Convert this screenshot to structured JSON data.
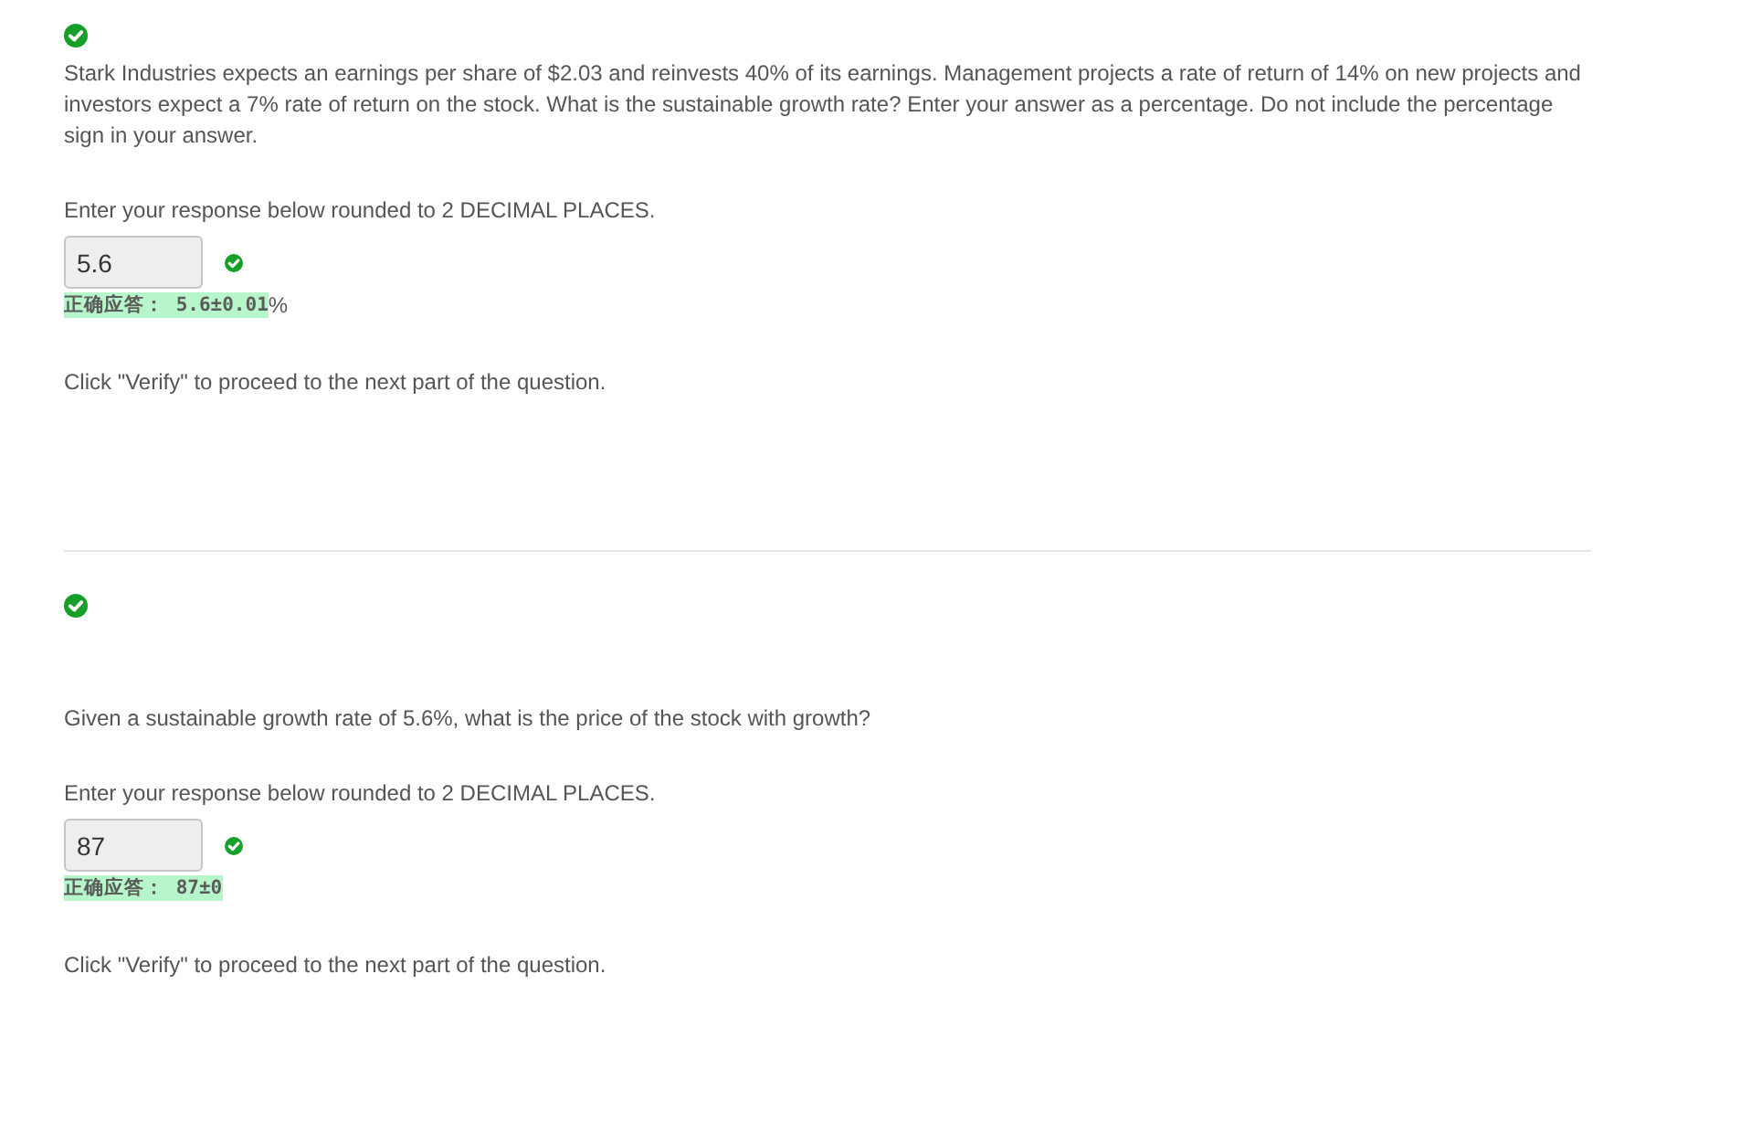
{
  "parts": [
    {
      "correct": true,
      "question": "Stark Industries expects an earnings per share of $2.03 and reinvests 40% of its earnings. Management projects a rate of return of 14% on new projects and investors expect a 7% rate of return on the stock. What is the sustainable growth rate? Enter your answer as a percentage. Do not include the percentage sign in your answer.",
      "instruction": "Enter your response below rounded to 2 DECIMAL PLACES.",
      "response": {
        "value": "5.6",
        "correct": true
      },
      "correct_answer": {
        "text": "正确应答： 5.6±0.01",
        "suffix": "%"
      },
      "note": "Click \"Verify\" to proceed to the next part of the question."
    },
    {
      "correct": true,
      "question": "Given a sustainable growth rate of 5.6%, what is the price of the stock with growth?",
      "instruction": "Enter your response below rounded to 2 DECIMAL PLACES.",
      "response": {
        "value": "87",
        "correct": true
      },
      "correct_answer": {
        "text": "正确应答： 87±0"
      },
      "note": "Click \"Verify\" to proceed to the next part of the question."
    }
  ]
}
